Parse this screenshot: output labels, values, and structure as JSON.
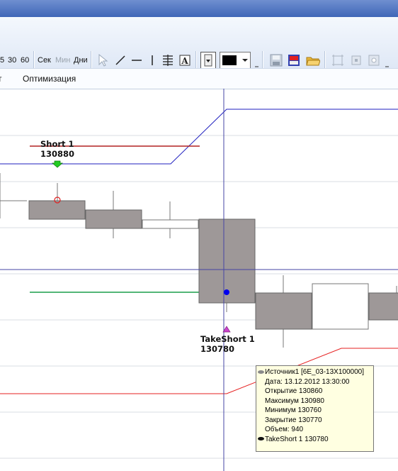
{
  "toolbar": {
    "intervals": [
      "5",
      "30",
      "60"
    ],
    "unit_labels": [
      {
        "text": "Сек",
        "enabled": true
      },
      {
        "text": "Мин",
        "enabled": false
      },
      {
        "text": "Дни",
        "enabled": true
      }
    ],
    "color_swatch": "#000000"
  },
  "menu": {
    "items": [
      "т",
      "Оптимизация"
    ]
  },
  "chart": {
    "colors": {
      "bar_fill": "#9e9898",
      "equity_line": "#1f1fbf",
      "short_line": "#b22222",
      "take_line": "#1a9e4a",
      "lower_line": "#e62020",
      "crosshair": "#4545a5",
      "grid": "#d9dde3"
    },
    "annotations": {
      "short_label": "Short 1",
      "short_price": "130880",
      "take_label": "TakeShort 1",
      "take_price": "130780"
    }
  },
  "tooltip": {
    "source": "Источник1 [6E_03-13X100000]",
    "date": "Дата: 13.12.2012 13:30:00",
    "open": "Открытие 130860",
    "high": "Максимум 130980",
    "low": "Минимум 130760",
    "close": "Закрытие 130770",
    "volume": "Объем: 940",
    "take": "TakeShort 1 130780"
  }
}
